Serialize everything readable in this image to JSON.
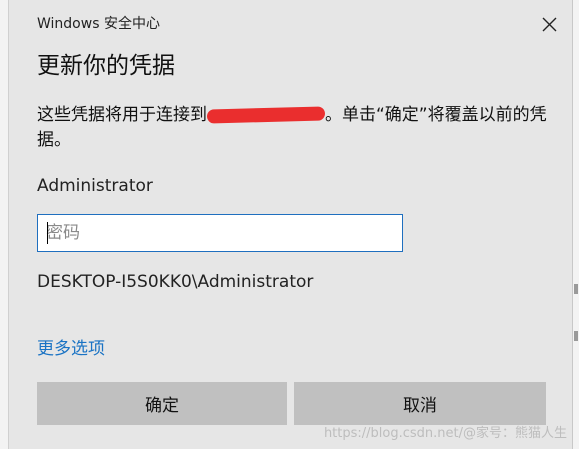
{
  "window": {
    "app_title": "Windows 安全中心"
  },
  "dialog": {
    "heading": "更新你的凭据",
    "message_before": "这些凭据将用于连接到",
    "message_after": "。单击“确定”将覆盖以前的凭据。",
    "username": "Administrator",
    "password_placeholder": "密码",
    "password_value": "",
    "domain_user": "DESKTOP-I5S0KK0\\Administrator",
    "more_options": "更多选项",
    "ok_label": "确定",
    "cancel_label": "取消"
  },
  "watermark": "https://blog.csdn.net/@家号：熊猫人生",
  "colors": {
    "dialog_bg": "#e6e6e6",
    "button_bg": "#c0c0c0",
    "link": "#1a73c4",
    "input_border": "#1f6fbf",
    "redaction": "#ea2e2e"
  },
  "icons": {
    "close": "close-icon"
  }
}
